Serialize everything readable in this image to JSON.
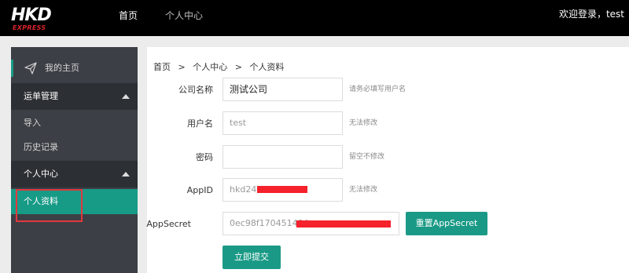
{
  "header": {
    "logo_main": "HKD",
    "logo_sub": "EXPRESS",
    "nav": [
      "首页",
      "个人中心"
    ],
    "welcome": "欢迎登录，test"
  },
  "sidebar": {
    "home": "我的主页",
    "groups": [
      {
        "label": "运单管理",
        "items": [
          "导入",
          "历史记录"
        ]
      },
      {
        "label": "个人中心",
        "items": [
          "个人资料"
        ]
      }
    ]
  },
  "breadcrumb": [
    "首页",
    ">",
    "个人中心",
    ">",
    "个人资料"
  ],
  "form": {
    "company": {
      "label": "公司名称",
      "value": "测试公司",
      "hint": "请务必填写用户名"
    },
    "username": {
      "label": "用户名",
      "value": "test",
      "hint": "无法修改"
    },
    "password": {
      "label": "密码",
      "value": "",
      "hint": "留空不修改"
    },
    "appid": {
      "label": "AppID",
      "value": "hkd24",
      "hint": "无法修改"
    },
    "appsecret": {
      "label": "AppSecret",
      "value": "0ec98f170451484"
    },
    "reset_button": "重置AppSecret",
    "submit_button": "立即提交"
  },
  "colors": {
    "accent": "#1a9a86",
    "topbar": "#000000",
    "sidebar": "#3c3f45",
    "redaction": "#f5212b"
  }
}
